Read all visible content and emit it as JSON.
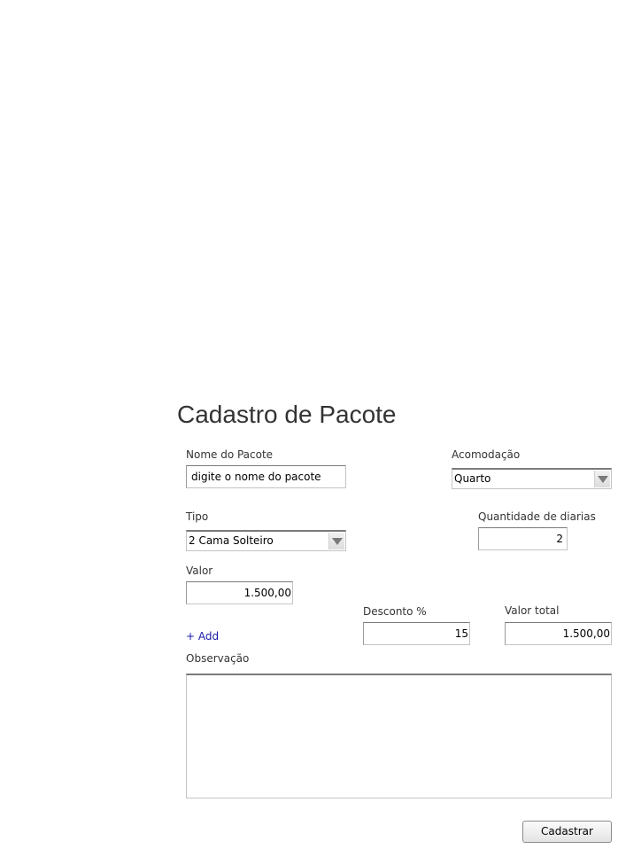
{
  "page": {
    "title": "Cadastro de Pacote"
  },
  "form": {
    "nome_pacote": {
      "label": "Nome do Pacote",
      "value": "digite o nome do pacote"
    },
    "acomodacao": {
      "label": "Acomodação",
      "selected": "Quarto"
    },
    "tipo": {
      "label": "Tipo",
      "selected": "2 Cama Solteiro"
    },
    "quantidade_diarias": {
      "label": "Quantidade de diarias",
      "value": "2"
    },
    "valor": {
      "label": "Valor",
      "value": "1.500,00"
    },
    "add_link": "+ Add",
    "desconto": {
      "label": "Desconto %",
      "value": "15"
    },
    "valor_total": {
      "label": "Valor total",
      "value": "1.500,00"
    },
    "observacao": {
      "label": "Observação",
      "value": ""
    },
    "submit_label": "Cadastrar"
  },
  "icons": {
    "select_arrow": "chevron-down-icon"
  },
  "colors": {
    "link": "#1a1aa6",
    "text": "#333333",
    "border": "#c4c4c4"
  }
}
